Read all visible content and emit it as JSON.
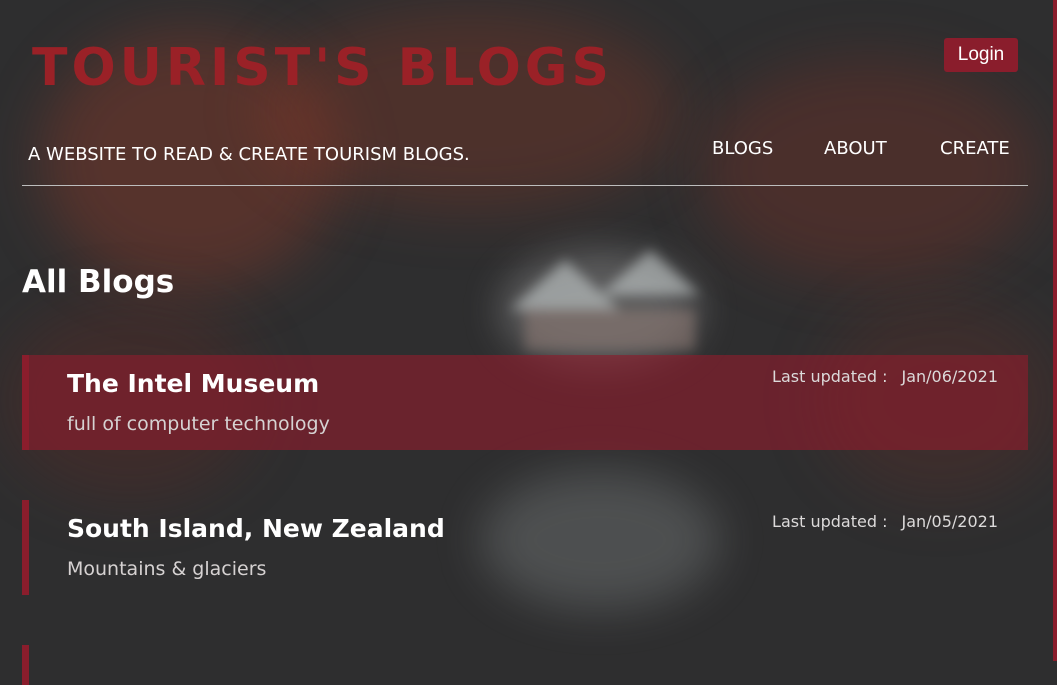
{
  "header": {
    "site_title": "TOURIST'S BLOGS",
    "tagline": "A WEBSITE TO READ & CREATE TOURISM BLOGS.",
    "login_label": "Login",
    "nav": [
      "BLOGS",
      "ABOUT",
      "CREATE"
    ]
  },
  "main": {
    "section_title": "All Blogs",
    "blogs": [
      {
        "title": "The Intel Museum",
        "description": "full of computer technology",
        "updated_label": "Last updated :",
        "updated_date": "Jan/06/2021"
      },
      {
        "title": "South Island, New Zealand",
        "description": "Mountains & glaciers",
        "updated_label": "Last updated :",
        "updated_date": "Jan/05/2021"
      }
    ]
  },
  "colors": {
    "accent": "#8a1d2c",
    "title_red": "#9a2127",
    "background": "#2e2e2f"
  }
}
